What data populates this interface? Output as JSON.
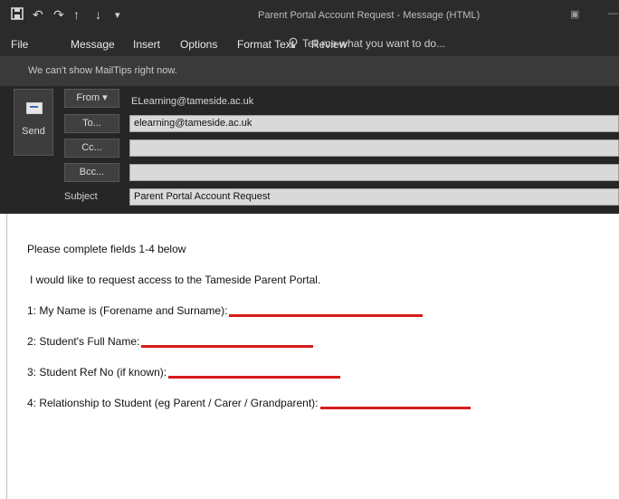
{
  "window": {
    "title": "Parent Portal Account Request - Message (HTML)",
    "qat_icons": [
      "save-icon",
      "undo-icon",
      "redo-icon",
      "up-arrow-icon",
      "down-arrow-icon",
      "customize-qat-icon"
    ],
    "controls": [
      "ribbon-display-options-icon",
      "minimize-icon"
    ]
  },
  "ribbon": {
    "tabs": [
      "File",
      "Message",
      "Insert",
      "Options",
      "Format Text",
      "Review"
    ],
    "tell_me": "Tell me what you want to do..."
  },
  "mailtips": "We can't show MailTips right now.",
  "compose": {
    "send_label": "Send",
    "from_label": "From ▾",
    "from_value": "ELearning@tameside.ac.uk",
    "to_label": "To...",
    "to_value": "elearning@tameside.ac.uk",
    "cc_label": "Cc...",
    "cc_value": "",
    "bcc_label": "Bcc...",
    "bcc_value": "",
    "subject_label": "Subject",
    "subject_value": "Parent Portal Account Request"
  },
  "body": {
    "intro": "Please complete fields 1-4 below",
    "request": "I would like to request access to the Tameside Parent Portal.",
    "fields": [
      "1: My Name is (Forename and Surname):",
      "2: Student's Full Name:",
      "3: Student Ref No (if known):",
      "4: Relationship to Student (eg Parent / Carer / Grandparent):"
    ]
  },
  "colors": {
    "underline": "#d81b1b",
    "titlebar": "#2b2b2b"
  }
}
